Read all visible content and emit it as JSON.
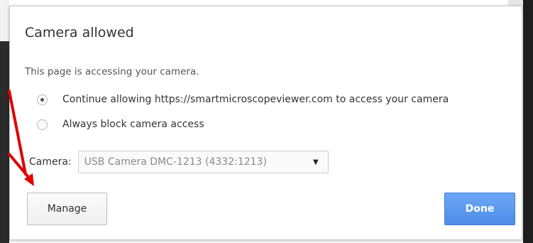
{
  "dialog": {
    "title": "Camera allowed",
    "subtitle": "This page is accessing your camera.",
    "options": [
      {
        "label": "Continue allowing https://smartmicroscopeviewer.com to access your camera",
        "selected": true
      },
      {
        "label": "Always block camera access",
        "selected": false
      }
    ],
    "camera": {
      "label": "Camera:",
      "selected": "USB Camera DMC-1213 (4332:1213)"
    },
    "manage_label": "Manage",
    "done_label": "Done"
  },
  "colors": {
    "done_button": "#4d8de7",
    "annotation_arrow": "#e00000"
  },
  "icons": {
    "dropdown": "triangle-down",
    "annotation": "red-arrow"
  }
}
